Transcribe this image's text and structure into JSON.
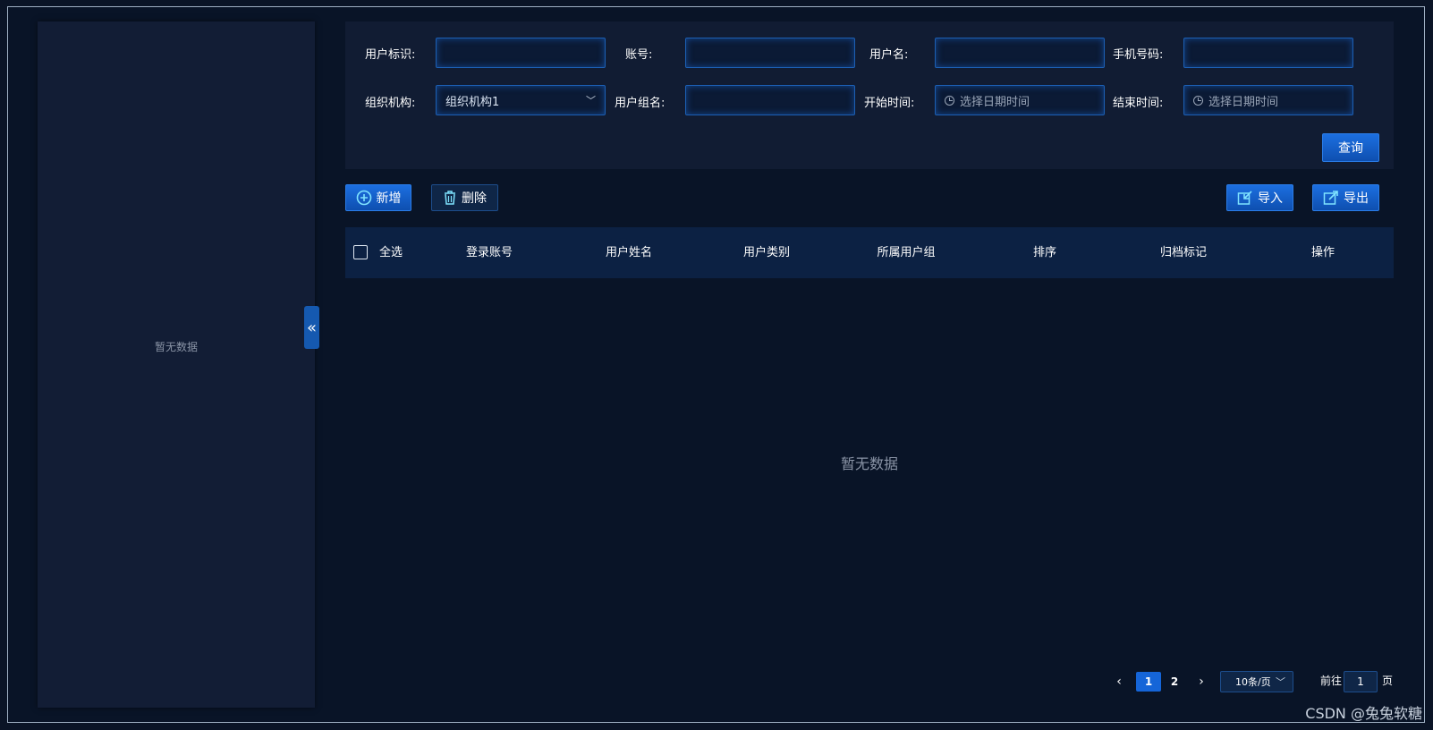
{
  "sidebar": {
    "empty_text": "暂无数据",
    "collapse_glyph": "«"
  },
  "search": {
    "labels": {
      "user_id": "用户标识:",
      "account": "账号:",
      "username": "用户名:",
      "phone": "手机号码:",
      "org": "组织机构:",
      "user_group": "用户组名:",
      "start_time": "开始时间:",
      "end_time": "结束时间:"
    },
    "values": {
      "user_id": "",
      "account": "",
      "username": "",
      "phone": "",
      "org": "组织机构1",
      "user_group": ""
    },
    "placeholders": {
      "start_time": "选择日期时间",
      "end_time": "选择日期时间"
    },
    "query_button": "查询"
  },
  "toolbar": {
    "add": "新增",
    "delete": "删除",
    "import": "导入",
    "export": "导出"
  },
  "table": {
    "select_all": "全选",
    "columns": [
      "登录账号",
      "用户姓名",
      "用户类别",
      "所属用户组",
      "排序",
      "归档标记",
      "操作"
    ],
    "empty_text": "暂无数据"
  },
  "pagination": {
    "prev": "‹",
    "next": "›",
    "pages": [
      "1",
      "2"
    ],
    "current_page": "1",
    "page_size": "10条/页",
    "goto_prefix": "前往",
    "goto_value": "1",
    "goto_suffix": "页"
  },
  "watermark": "CSDN @兔兔软糖",
  "colors": {
    "accent": "#1565d8",
    "panel": "#111c33",
    "background": "#091427",
    "header": "#0c2143"
  }
}
